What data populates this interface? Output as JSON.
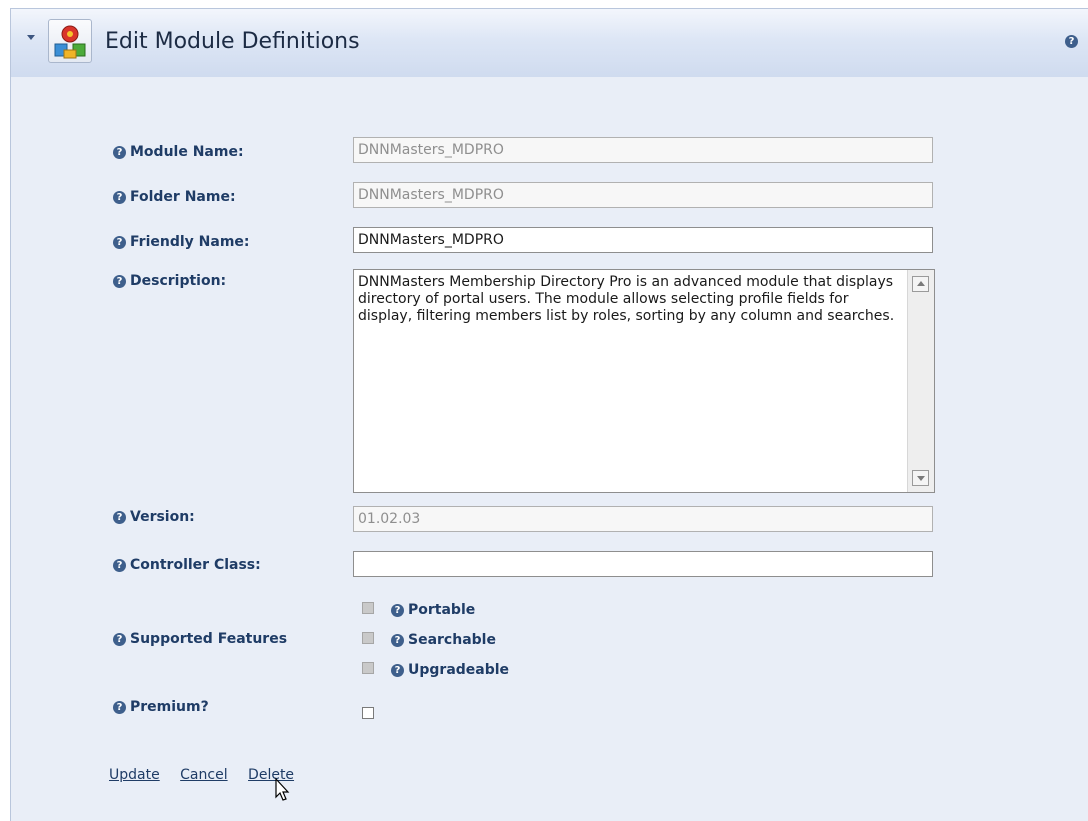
{
  "header": {
    "title": "Edit Module Definitions",
    "collapse_icon": "triangle-down-icon",
    "module_icon": "module-definitions-icon",
    "help_icon": "help-icon"
  },
  "form": {
    "module_name": {
      "label": "Module Name:",
      "value": "DNNMasters_MDPRO"
    },
    "folder_name": {
      "label": "Folder Name:",
      "value": "DNNMasters_MDPRO"
    },
    "friendly_name": {
      "label": "Friendly Name:",
      "value": "DNNMasters_MDPRO"
    },
    "description": {
      "label": "Description:",
      "value": "DNNMasters Membership Directory Pro is an advanced module that displays directory of portal users. The module allows selecting profile fields for display, filtering members list by roles, sorting by any column and searches."
    },
    "version": {
      "label": "Version:",
      "value": "01.02.03"
    },
    "controller_class": {
      "label": "Controller Class:",
      "value": ""
    },
    "supported_features": {
      "label": "Supported Features",
      "items": [
        {
          "label": "Portable",
          "checked": false
        },
        {
          "label": "Searchable",
          "checked": false
        },
        {
          "label": "Upgradeable",
          "checked": false
        }
      ]
    },
    "premium": {
      "label": "Premium?",
      "checked": false
    }
  },
  "actions": {
    "update": "Update",
    "cancel": "Cancel",
    "delete": "Delete"
  },
  "colors": {
    "label": "#1f3c66",
    "panel_bg": "#e9eef7",
    "title_gradient_top": "#f3f6fc",
    "title_gradient_bottom": "#cfdbef"
  }
}
